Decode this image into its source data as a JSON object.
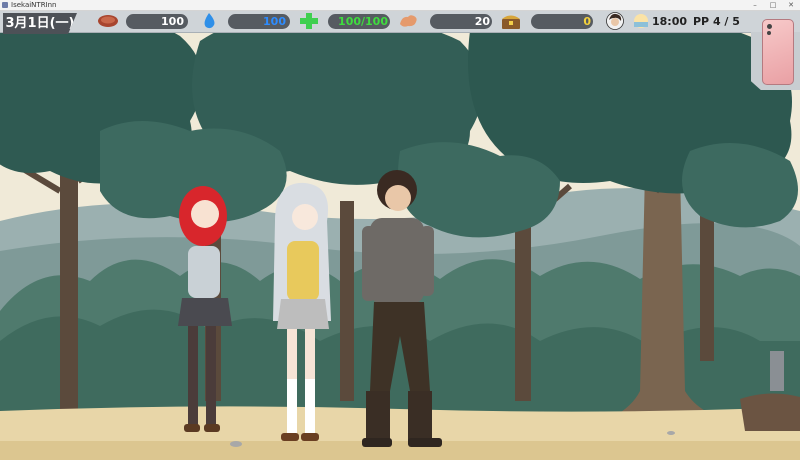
{
  "window": {
    "title": "IsekaiNTRInn"
  },
  "hud": {
    "date": "3月1日(一)",
    "stats": [
      {
        "name": "food",
        "value": "100",
        "color": "#ffffff"
      },
      {
        "name": "water",
        "value": "100",
        "color": "#2d8cff"
      },
      {
        "name": "health",
        "value": "100/100",
        "color": "#3fdc3f"
      },
      {
        "name": "stamina",
        "value": "20",
        "color": "#ffffff"
      },
      {
        "name": "gold",
        "value": "0",
        "color": "#f4d23c"
      }
    ],
    "time": "18:00",
    "pp": "PP 4 / 5"
  },
  "icons": {
    "food": "meat-icon",
    "water": "water-drop-icon",
    "health": "health-cross-icon",
    "stamina": "arm-icon",
    "gold": "treasure-chest-icon",
    "character": "character-portrait-icon",
    "time": "evening-sun-icon",
    "phone": "smartphone-icon"
  }
}
